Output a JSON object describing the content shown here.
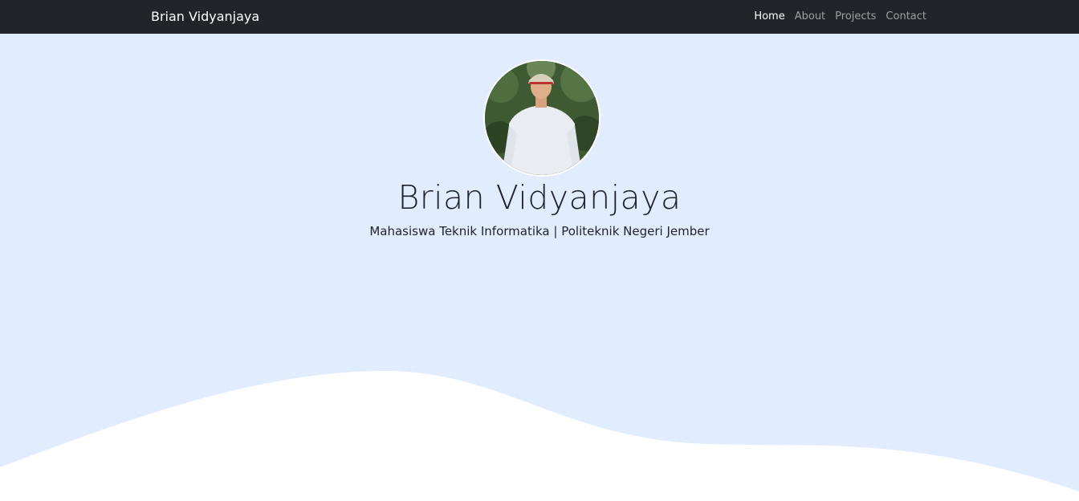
{
  "navbar": {
    "brand": "Brian Vidyanjaya",
    "links": [
      {
        "label": "Home",
        "active": true
      },
      {
        "label": "About",
        "active": false
      },
      {
        "label": "Projects",
        "active": false
      },
      {
        "label": "Contact",
        "active": false
      }
    ]
  },
  "hero": {
    "name": "Brian Vidyanjaya",
    "subtitle": "Mahasiswa Teknik Informatika | Politeknik Negeri Jember"
  },
  "colors": {
    "navbar_bg": "#212529",
    "hero_bg": "#e1ecff",
    "wave": "#ffffff"
  }
}
